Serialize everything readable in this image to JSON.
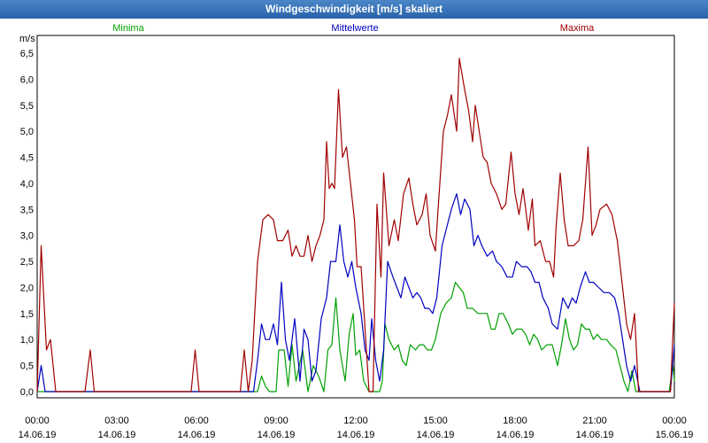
{
  "window": {
    "title": "Windgeschwindigkeit [m/s] skaliert"
  },
  "colors": {
    "minima": "#00a000",
    "mittelwerte": "#0000c0",
    "maxima": "#a00000",
    "grid": "#000000",
    "titlebar": "#2a63a8"
  },
  "chart_data": {
    "type": "line",
    "title": "Windgeschwindigkeit [m/s] skaliert",
    "ylabel": "m/s",
    "xlabel": "",
    "ylim": [
      0,
      6.6
    ],
    "xlim_hours": [
      0,
      24
    ],
    "grid": true,
    "legend_placement": "top",
    "y_ticks": [
      "0,0",
      "0,5",
      "1,0",
      "1,5",
      "2,0",
      "2,5",
      "3,0",
      "3,5",
      "4,0",
      "4,5",
      "5,0",
      "5,5",
      "6,0",
      "6,5"
    ],
    "x_ticks": [
      {
        "time": "00:00",
        "date": "14.06.19"
      },
      {
        "time": "03:00",
        "date": "14.06.19"
      },
      {
        "time": "06:00",
        "date": "14.06.19"
      },
      {
        "time": "09:00",
        "date": "14.06.19"
      },
      {
        "time": "12:00",
        "date": "14.06.19"
      },
      {
        "time": "15:00",
        "date": "14.06.19"
      },
      {
        "time": "18:00",
        "date": "14.06.19"
      },
      {
        "time": "21:00",
        "date": "14.06.19"
      },
      {
        "time": "00:00",
        "date": "15.06.19"
      }
    ],
    "series": [
      {
        "name": "Minima",
        "color": "#00a000",
        "points": [
          [
            0,
            0
          ],
          [
            8.3,
            0
          ],
          [
            8.45,
            0.3
          ],
          [
            8.6,
            0.1
          ],
          [
            8.75,
            0
          ],
          [
            9.0,
            0
          ],
          [
            9.1,
            0.8
          ],
          [
            9.3,
            0.8
          ],
          [
            9.45,
            0.1
          ],
          [
            9.6,
            0.9
          ],
          [
            9.75,
            0.2
          ],
          [
            10.0,
            0.8
          ],
          [
            10.2,
            0
          ],
          [
            10.4,
            0.5
          ],
          [
            10.6,
            0.3
          ],
          [
            10.8,
            0
          ],
          [
            10.95,
            0.8
          ],
          [
            11.1,
            0.9
          ],
          [
            11.25,
            1.8
          ],
          [
            11.4,
            0.8
          ],
          [
            11.6,
            0.2
          ],
          [
            11.75,
            1.1
          ],
          [
            11.9,
            1.5
          ],
          [
            12.0,
            0.7
          ],
          [
            12.15,
            0.8
          ],
          [
            12.3,
            0.2
          ],
          [
            12.5,
            0
          ],
          [
            12.7,
            0
          ],
          [
            12.9,
            0
          ],
          [
            13.0,
            0.2
          ],
          [
            13.1,
            1.3
          ],
          [
            13.25,
            1.0
          ],
          [
            13.45,
            0.8
          ],
          [
            13.6,
            0.9
          ],
          [
            13.75,
            0.6
          ],
          [
            13.9,
            0.5
          ],
          [
            14.05,
            0.9
          ],
          [
            14.25,
            0.8
          ],
          [
            14.4,
            0.9
          ],
          [
            14.55,
            0.9
          ],
          [
            14.7,
            0.8
          ],
          [
            14.85,
            0.8
          ],
          [
            15.0,
            1.0
          ],
          [
            15.2,
            1.5
          ],
          [
            15.4,
            1.7
          ],
          [
            15.6,
            1.8
          ],
          [
            15.75,
            2.1
          ],
          [
            15.9,
            2.0
          ],
          [
            16.05,
            1.9
          ],
          [
            16.2,
            1.6
          ],
          [
            16.4,
            1.6
          ],
          [
            16.6,
            1.5
          ],
          [
            16.75,
            1.5
          ],
          [
            16.95,
            1.5
          ],
          [
            17.1,
            1.2
          ],
          [
            17.25,
            1.2
          ],
          [
            17.4,
            1.5
          ],
          [
            17.55,
            1.5
          ],
          [
            17.75,
            1.3
          ],
          [
            17.9,
            1.1
          ],
          [
            18.05,
            1.2
          ],
          [
            18.25,
            1.2
          ],
          [
            18.4,
            1.1
          ],
          [
            18.55,
            0.9
          ],
          [
            18.7,
            1.1
          ],
          [
            18.85,
            1.0
          ],
          [
            19.0,
            0.8
          ],
          [
            19.2,
            0.9
          ],
          [
            19.4,
            0.9
          ],
          [
            19.6,
            0.5
          ],
          [
            19.75,
            0.9
          ],
          [
            19.9,
            1.4
          ],
          [
            20.05,
            1.0
          ],
          [
            20.2,
            0.8
          ],
          [
            20.35,
            0.9
          ],
          [
            20.5,
            1.3
          ],
          [
            20.65,
            1.2
          ],
          [
            20.8,
            1.2
          ],
          [
            20.95,
            1.0
          ],
          [
            21.1,
            1.1
          ],
          [
            21.25,
            1.0
          ],
          [
            21.45,
            1.0
          ],
          [
            21.6,
            0.9
          ],
          [
            21.8,
            0.8
          ],
          [
            21.95,
            0.5
          ],
          [
            22.1,
            0.2
          ],
          [
            22.25,
            0
          ],
          [
            22.4,
            0.4
          ],
          [
            22.55,
            0
          ],
          [
            22.7,
            0
          ],
          [
            23.0,
            0
          ],
          [
            23.5,
            0
          ],
          [
            23.8,
            0
          ],
          [
            23.95,
            0.5
          ],
          [
            24.0,
            0.2
          ]
        ]
      },
      {
        "name": "Mittelwerte",
        "color": "#0000c0",
        "points": [
          [
            0,
            0
          ],
          [
            0.15,
            0.5
          ],
          [
            0.3,
            0
          ],
          [
            8.15,
            0
          ],
          [
            8.3,
            0.6
          ],
          [
            8.45,
            1.3
          ],
          [
            8.6,
            1.0
          ],
          [
            8.75,
            1.0
          ],
          [
            8.9,
            1.3
          ],
          [
            9.05,
            0.9
          ],
          [
            9.2,
            2.1
          ],
          [
            9.35,
            1.0
          ],
          [
            9.5,
            0.6
          ],
          [
            9.7,
            1.4
          ],
          [
            9.9,
            0.2
          ],
          [
            10.05,
            1.2
          ],
          [
            10.2,
            1.0
          ],
          [
            10.35,
            0.2
          ],
          [
            10.5,
            0.4
          ],
          [
            10.7,
            1.4
          ],
          [
            10.9,
            1.8
          ],
          [
            11.05,
            2.5
          ],
          [
            11.25,
            2.5
          ],
          [
            11.4,
            3.2
          ],
          [
            11.55,
            2.5
          ],
          [
            11.7,
            2.2
          ],
          [
            11.85,
            2.5
          ],
          [
            12.0,
            2.0
          ],
          [
            12.2,
            1.5
          ],
          [
            12.35,
            0.8
          ],
          [
            12.5,
            0.6
          ],
          [
            12.6,
            1.4
          ],
          [
            12.75,
            0.6
          ],
          [
            12.9,
            0.2
          ],
          [
            13.05,
            0.8
          ],
          [
            13.2,
            2.5
          ],
          [
            13.4,
            2.2
          ],
          [
            13.55,
            2.0
          ],
          [
            13.7,
            1.8
          ],
          [
            13.85,
            2.2
          ],
          [
            14.0,
            2.0
          ],
          [
            14.15,
            1.8
          ],
          [
            14.3,
            1.9
          ],
          [
            14.45,
            1.8
          ],
          [
            14.6,
            1.6
          ],
          [
            14.75,
            1.6
          ],
          [
            14.9,
            1.5
          ],
          [
            15.05,
            1.8
          ],
          [
            15.25,
            2.8
          ],
          [
            15.45,
            3.2
          ],
          [
            15.6,
            3.5
          ],
          [
            15.8,
            3.8
          ],
          [
            15.95,
            3.4
          ],
          [
            16.1,
            3.7
          ],
          [
            16.3,
            3.5
          ],
          [
            16.45,
            2.8
          ],
          [
            16.6,
            3.0
          ],
          [
            16.75,
            2.8
          ],
          [
            16.95,
            2.6
          ],
          [
            17.15,
            2.7
          ],
          [
            17.3,
            2.5
          ],
          [
            17.5,
            2.4
          ],
          [
            17.7,
            2.2
          ],
          [
            17.9,
            2.2
          ],
          [
            18.05,
            2.5
          ],
          [
            18.25,
            2.4
          ],
          [
            18.45,
            2.4
          ],
          [
            18.6,
            2.3
          ],
          [
            18.75,
            2.1
          ],
          [
            18.9,
            2.1
          ],
          [
            19.05,
            1.8
          ],
          [
            19.25,
            1.6
          ],
          [
            19.4,
            1.3
          ],
          [
            19.6,
            1.2
          ],
          [
            19.8,
            1.8
          ],
          [
            20.0,
            1.6
          ],
          [
            20.15,
            1.8
          ],
          [
            20.3,
            1.7
          ],
          [
            20.45,
            2.0
          ],
          [
            20.65,
            2.3
          ],
          [
            20.8,
            2.1
          ],
          [
            20.95,
            2.1
          ],
          [
            21.15,
            2.0
          ],
          [
            21.35,
            1.9
          ],
          [
            21.55,
            1.9
          ],
          [
            21.75,
            1.8
          ],
          [
            21.9,
            1.5
          ],
          [
            22.05,
            1.0
          ],
          [
            22.2,
            0.5
          ],
          [
            22.35,
            0.2
          ],
          [
            22.5,
            0.5
          ],
          [
            22.7,
            0
          ],
          [
            22.95,
            0
          ],
          [
            23.5,
            0
          ],
          [
            23.85,
            0
          ],
          [
            24.0,
            0.9
          ]
        ]
      },
      {
        "name": "Maxima",
        "color": "#a00000",
        "points": [
          [
            0,
            0
          ],
          [
            0.15,
            2.8
          ],
          [
            0.35,
            0.8
          ],
          [
            0.5,
            1.0
          ],
          [
            0.7,
            0
          ],
          [
            1.8,
            0
          ],
          [
            2.0,
            0.8
          ],
          [
            2.15,
            0
          ],
          [
            5.8,
            0
          ],
          [
            5.95,
            0.8
          ],
          [
            6.1,
            0
          ],
          [
            7.65,
            0
          ],
          [
            7.8,
            0.8
          ],
          [
            7.95,
            0
          ],
          [
            8.1,
            0.6
          ],
          [
            8.3,
            2.5
          ],
          [
            8.5,
            3.3
          ],
          [
            8.7,
            3.4
          ],
          [
            8.9,
            3.3
          ],
          [
            9.05,
            2.9
          ],
          [
            9.25,
            2.9
          ],
          [
            9.45,
            3.1
          ],
          [
            9.6,
            2.6
          ],
          [
            9.75,
            2.8
          ],
          [
            9.9,
            2.6
          ],
          [
            10.05,
            2.6
          ],
          [
            10.2,
            3.0
          ],
          [
            10.35,
            2.5
          ],
          [
            10.5,
            2.8
          ],
          [
            10.65,
            3.0
          ],
          [
            10.8,
            3.3
          ],
          [
            10.9,
            4.8
          ],
          [
            11.0,
            3.9
          ],
          [
            11.1,
            4.0
          ],
          [
            11.2,
            3.9
          ],
          [
            11.35,
            5.8
          ],
          [
            11.5,
            4.5
          ],
          [
            11.65,
            4.7
          ],
          [
            11.8,
            4.0
          ],
          [
            11.95,
            3.3
          ],
          [
            12.05,
            2.4
          ],
          [
            12.2,
            2.4
          ],
          [
            12.35,
            1.2
          ],
          [
            12.5,
            0
          ],
          [
            12.65,
            0
          ],
          [
            12.8,
            3.6
          ],
          [
            12.95,
            2.2
          ],
          [
            13.05,
            4.2
          ],
          [
            13.25,
            2.8
          ],
          [
            13.45,
            3.3
          ],
          [
            13.6,
            2.9
          ],
          [
            13.8,
            3.8
          ],
          [
            14.0,
            4.1
          ],
          [
            14.15,
            3.6
          ],
          [
            14.3,
            3.2
          ],
          [
            14.5,
            3.4
          ],
          [
            14.65,
            3.8
          ],
          [
            14.8,
            3.0
          ],
          [
            15.0,
            2.7
          ],
          [
            15.1,
            3.5
          ],
          [
            15.3,
            5.0
          ],
          [
            15.45,
            5.3
          ],
          [
            15.6,
            5.7
          ],
          [
            15.8,
            5.0
          ],
          [
            15.9,
            6.4
          ],
          [
            16.1,
            5.8
          ],
          [
            16.25,
            5.4
          ],
          [
            16.4,
            4.8
          ],
          [
            16.5,
            5.5
          ],
          [
            16.65,
            5.0
          ],
          [
            16.8,
            4.5
          ],
          [
            16.95,
            4.4
          ],
          [
            17.1,
            4.0
          ],
          [
            17.3,
            3.8
          ],
          [
            17.5,
            3.5
          ],
          [
            17.65,
            3.6
          ],
          [
            17.85,
            4.6
          ],
          [
            18.0,
            3.8
          ],
          [
            18.15,
            3.4
          ],
          [
            18.3,
            3.9
          ],
          [
            18.5,
            3.1
          ],
          [
            18.65,
            3.7
          ],
          [
            18.75,
            2.8
          ],
          [
            18.95,
            2.9
          ],
          [
            19.15,
            2.5
          ],
          [
            19.3,
            2.5
          ],
          [
            19.45,
            2.2
          ],
          [
            19.55,
            3.2
          ],
          [
            19.7,
            4.2
          ],
          [
            19.85,
            3.3
          ],
          [
            20.0,
            2.8
          ],
          [
            20.2,
            2.8
          ],
          [
            20.4,
            2.9
          ],
          [
            20.55,
            3.3
          ],
          [
            20.75,
            4.7
          ],
          [
            20.9,
            3.0
          ],
          [
            21.05,
            3.2
          ],
          [
            21.2,
            3.5
          ],
          [
            21.45,
            3.6
          ],
          [
            21.65,
            3.4
          ],
          [
            21.85,
            2.9
          ],
          [
            22.05,
            2.0
          ],
          [
            22.2,
            1.3
          ],
          [
            22.35,
            1.0
          ],
          [
            22.5,
            1.5
          ],
          [
            22.65,
            0
          ],
          [
            23.85,
            0
          ],
          [
            24.0,
            1.7
          ]
        ]
      }
    ]
  }
}
